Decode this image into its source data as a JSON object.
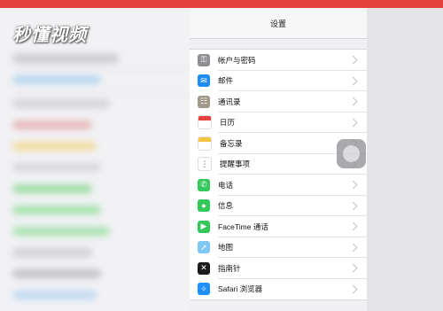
{
  "watermark": "秒懂视频",
  "nav": {
    "title": "设置"
  },
  "settings": [
    {
      "label": "帐户与密码",
      "icon": "key-icon",
      "color": "#8e8e93",
      "glyph": "⚿"
    },
    {
      "label": "邮件",
      "icon": "mail-icon",
      "color": "#1e8cf0",
      "glyph": "✉"
    },
    {
      "label": "通讯录",
      "icon": "contacts-icon",
      "color": "#a19a8c",
      "glyph": "☷"
    },
    {
      "label": "日历",
      "icon": "calendar-icon",
      "color": "#ffffff",
      "glyph": ""
    },
    {
      "label": "备忘录",
      "icon": "notes-icon",
      "color": "#ffffff",
      "glyph": ""
    },
    {
      "label": "提醒事项",
      "icon": "reminders-icon",
      "color": "#ffffff",
      "glyph": "⋮"
    },
    {
      "label": "电话",
      "icon": "phone-icon",
      "color": "#34c759",
      "glyph": "✆"
    },
    {
      "label": "信息",
      "icon": "messages-icon",
      "color": "#34c759",
      "glyph": "●"
    },
    {
      "label": "FaceTime 通话",
      "icon": "facetime-icon",
      "color": "#34c759",
      "glyph": "▶"
    },
    {
      "label": "地图",
      "icon": "maps-icon",
      "color": "#7fc7f5",
      "glyph": "➚"
    },
    {
      "label": "指南针",
      "icon": "compass-icon",
      "color": "#1c1c1e",
      "glyph": "✕"
    },
    {
      "label": "Safari 浏览器",
      "icon": "safari-icon",
      "color": "#1e90ff",
      "glyph": "✧"
    }
  ]
}
